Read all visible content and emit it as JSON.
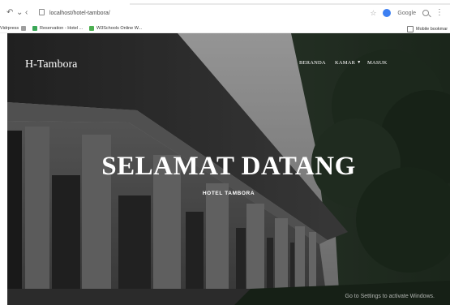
{
  "browser": {
    "url": "localhost/hotel-tambora/",
    "search_engine": "Google",
    "bookmarks": [
      {
        "label": "Vidrpress",
        "icon": "doc-icon"
      },
      {
        "label": "Reservation - Hotel ...",
        "icon": "globe-icon"
      },
      {
        "label": "W3Schools Online W...",
        "icon": "w3schools-icon"
      },
      {
        "label": "Mobile bookmar",
        "icon": "mobile-bookmarks-icon"
      }
    ]
  },
  "site": {
    "brand": "H-Tambora",
    "nav": [
      {
        "label": "BERANDA"
      },
      {
        "label": "KAMAR"
      },
      {
        "label": "MASUK"
      }
    ],
    "hero": {
      "title": "SELAMAT DATANG",
      "subtitle": "HOTEL TAMBORA"
    },
    "watermark": {
      "line1": "Go to Settings to activate Windows."
    }
  },
  "colors": {
    "accent_blue": "#3c7ff2",
    "hero_text": "#ffffff"
  }
}
